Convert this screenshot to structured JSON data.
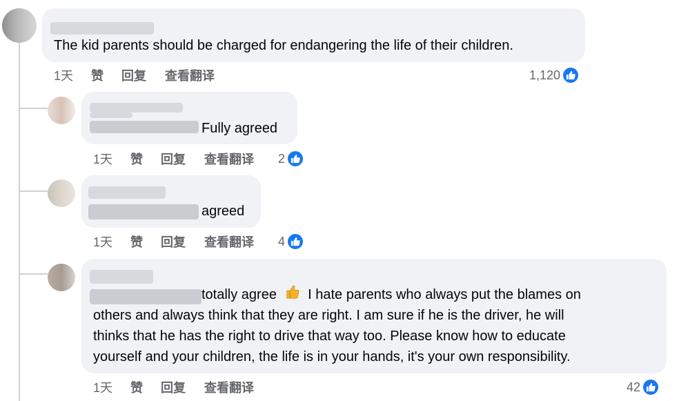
{
  "colors": {
    "bubble": "#f0f2f5",
    "like_blue": "#1877f2",
    "meta_text": "#65676b",
    "thread_line": "#ced0d4"
  },
  "icons": {
    "like": "like-thumb-icon",
    "thumbs_up_emoji": "thumbs-up-emoji-icon"
  },
  "actions": {
    "like": "赞",
    "reply": "回复",
    "translate": "查看翻译"
  },
  "comments": [
    {
      "text": "The kid parents should be charged for endangering the life of their children.",
      "time": "1天",
      "reactions": "1,120"
    },
    {
      "text": "Fully agreed",
      "time": "1天",
      "reactions": "2"
    },
    {
      "text": "agreed",
      "time": "1天",
      "reactions": "4"
    },
    {
      "text_part1": "totally agree",
      "text_part2": "I hate parents who always put the blames on",
      "lines": [
        "others and always think that they are right. I am sure if he is the driver, he will",
        "thinks that he has the right to drive that way too. Please know how to educate",
        "yourself and your children, the life is in your hands, it's your own responsibility."
      ],
      "time": "1天",
      "reactions": "42"
    }
  ]
}
